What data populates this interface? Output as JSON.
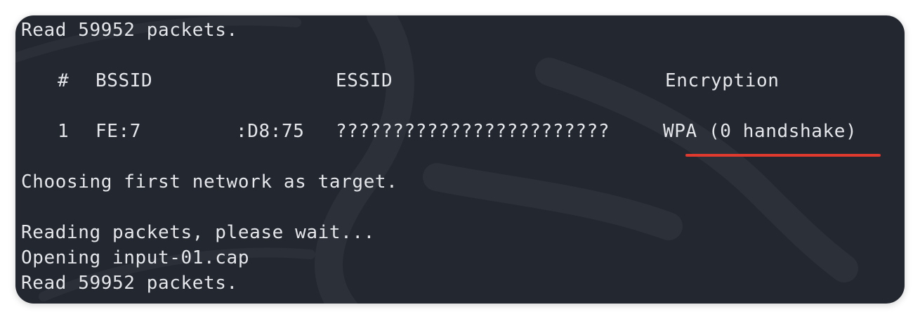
{
  "terminal": {
    "line_read_top": "Read 59952 packets.",
    "table_header": {
      "num": "#",
      "bssid": "BSSID",
      "essid": "ESSID",
      "encryption": "Encryption"
    },
    "table_row": {
      "num": "1",
      "bssid_start": "FE:7",
      "bssid_end": ":D8:75",
      "essid": "????????????????????????",
      "encryption": "WPA (0 handshake)"
    },
    "line_choosing": "Choosing first network as target.",
    "line_reading": "Reading packets, please wait...",
    "line_opening": "Opening input-01.cap",
    "line_read_bottom": "Read 59952 packets."
  },
  "colors": {
    "background": "#232730",
    "text": "#e4e6ea",
    "annotation_underline": "#e03a2f"
  }
}
